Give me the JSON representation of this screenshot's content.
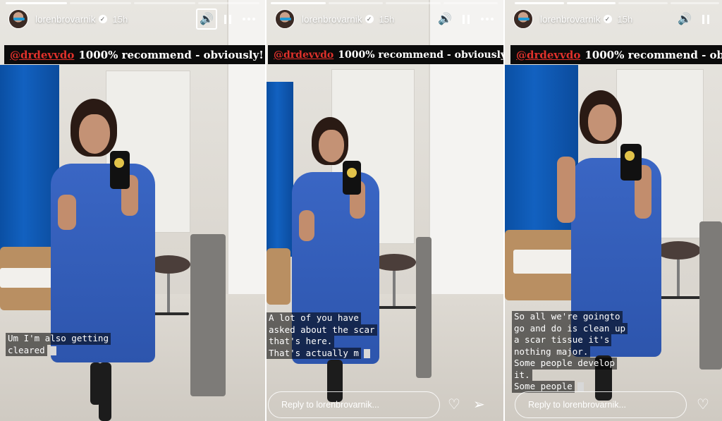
{
  "story": {
    "username": "lorenbrovarnik",
    "time": "15h",
    "banner_mention": "@drdevvdo",
    "banner_text": "1000% recommend - obviously!",
    "reply_placeholder": "Reply to lorenbrovarnik..."
  },
  "panels": [
    {
      "caption_lines": [
        "Um I'm also getting",
        "cleared"
      ]
    },
    {
      "caption_lines": [
        "A lot of you have",
        "asked about the scar",
        "that's here.",
        "That's actually m"
      ]
    },
    {
      "caption_lines": [
        "So all we're goingto",
        "go and do is clean up",
        "a scar tissue it's",
        "nothing major.",
        "Some people develop",
        "it.",
        "Some people"
      ]
    }
  ],
  "colors": {
    "banner_bg": "#0b0b0b",
    "mention": "#e0312b",
    "gown": "#2d55ad",
    "curtain": "#0a4fa3"
  },
  "icons": [
    "verified-badge-icon",
    "volume-icon",
    "pause-icon",
    "more-icon",
    "heart-icon",
    "send-icon"
  ]
}
